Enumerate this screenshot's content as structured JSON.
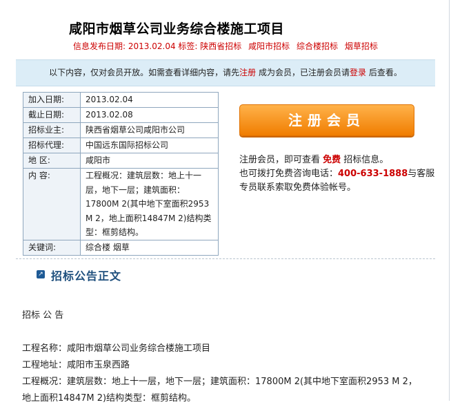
{
  "header": {
    "title": "咸阳市烟草公司业务综合楼施工项目",
    "publish_label": "信息发布日期:",
    "publish_date": "2013.02.04",
    "tags_label": "标签:",
    "tags": [
      "陕西省招标",
      "咸阳市招标",
      "综合楼招标",
      "烟草招标"
    ]
  },
  "notice": {
    "prefix": "以下内容，仅对会员开放。如需查看详细内容，请先",
    "register_link": "注册",
    "middle": " 成为会员，已注册会员请",
    "login_link": "登录",
    "suffix": " 后查看。"
  },
  "info_table": [
    {
      "key": "加入日期:",
      "value": "2013.02.04"
    },
    {
      "key": "截止日期:",
      "value": "2013.02.08"
    },
    {
      "key": "招标业主:",
      "value": "陕西省烟草公司咸阳市公司"
    },
    {
      "key": "招标代理:",
      "value": "中国远东国际招标公司"
    },
    {
      "key": "地  区:",
      "value": "咸阳市"
    },
    {
      "key": "内  容:",
      "value": "工程概况：建筑层数：地上十一层，地下一层；建筑面积：17800M 2(其中地下室面积2953 M 2，地上面积14847M 2)结构类型：框剪结构。"
    },
    {
      "key": "关键词:",
      "value": "综合楼 烟草"
    }
  ],
  "register": {
    "button_label": "注册会员",
    "line1_prefix": "注册会员，即可查看 ",
    "free": "免费",
    "line1_suffix": " 招标信息。",
    "line2_prefix": "也可拨打免费咨询电话：",
    "phone": "400-633-1888",
    "line2_suffix": "与客服专员联系索取免费体验帐号。"
  },
  "section": {
    "title": "招标公告正文"
  },
  "body": {
    "heading": "招标 公 告",
    "project_name": "工程名称：咸阳市烟草公司业务综合楼施工项目",
    "project_address": "工程地址：咸阳市玉泉西路",
    "project_overview": "工程概况：建筑层数：地上十一层，地下一层；建筑面积：17800M 2(其中地下室面积2953 M 2，地上面积14847M 2)结构类型：框剪结构。"
  }
}
